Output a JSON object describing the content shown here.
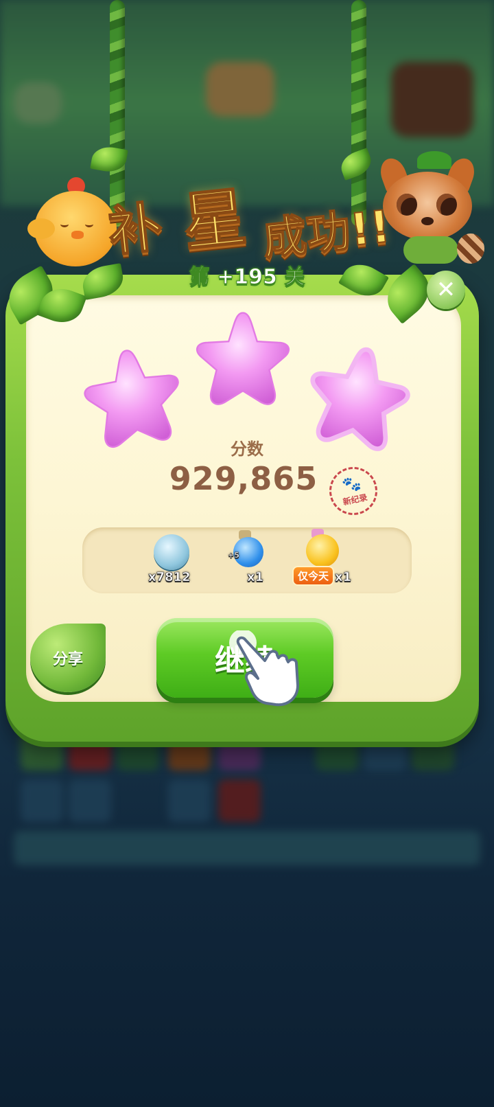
{
  "title": {
    "part1": "补",
    "part2": "星",
    "part3": "成功!!"
  },
  "level": {
    "text": "第 +195 关"
  },
  "close_icon": "close-icon",
  "stars": {
    "earned": 3,
    "total": 3,
    "color": "#ef8ef0"
  },
  "score": {
    "label": "分数",
    "value": "929,865",
    "record_badge": "新纪录"
  },
  "rewards": [
    {
      "icon": "silver-coin-icon",
      "count": "x7812"
    },
    {
      "icon": "blue-potion-icon",
      "tag": "+5",
      "count": "x1"
    },
    {
      "icon": "gold-potion-icon",
      "badge": "仅今天",
      "count": "x1"
    }
  ],
  "buttons": {
    "share": "分享",
    "continue": "继续"
  },
  "colors": {
    "panel_green": "#7cc13a",
    "panel_cream": "#fdf6d4",
    "score_brown": "#8d5f44",
    "button_green": "#5ecb25"
  }
}
